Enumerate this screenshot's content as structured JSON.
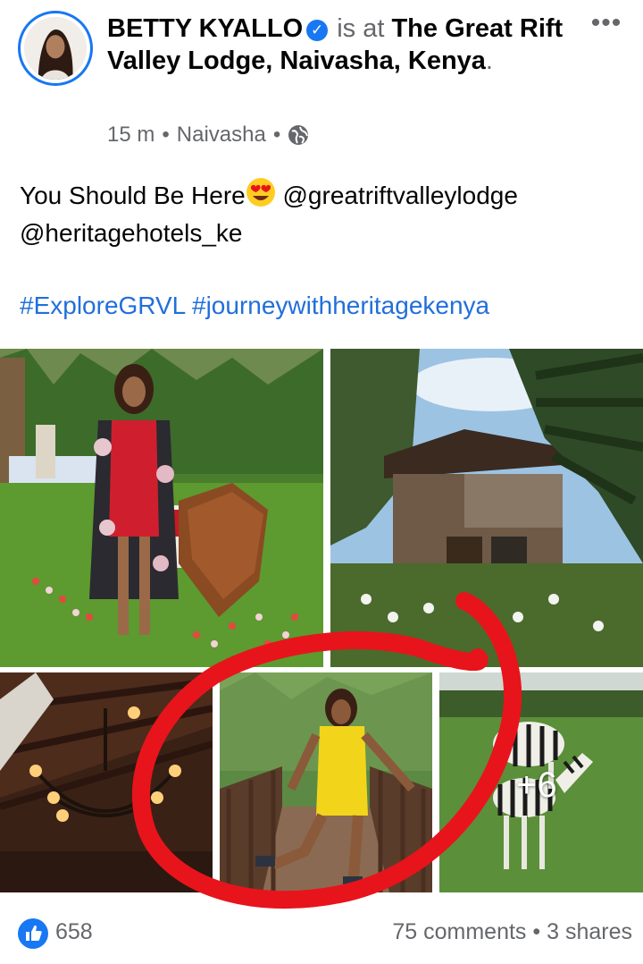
{
  "header": {
    "author": "BETTY KYALLO",
    "is_at": "is at",
    "place": "The Great Rift Valley Lodge, Naivasha, Kenya",
    "period": ".",
    "time": "15 m",
    "separator": "•",
    "location": "Naivasha",
    "separator2": "•",
    "more": "•••"
  },
  "post": {
    "text_before_emoji": "You Should Be Here",
    "text_after_emoji": " @greatriftvalleylodge @heritagehotels_ke",
    "hashtags": [
      "#ExploreGRVL",
      "#journeywithheritagekenya"
    ],
    "emoji_name": "heart-eyes-emoji"
  },
  "photos": {
    "more_count": "+6",
    "annotation_color": "#e8141b"
  },
  "footer": {
    "like_count": "658",
    "comments": "75 comments",
    "separator": "•",
    "shares": "3 shares"
  },
  "colors": {
    "accent": "#1877f2",
    "link": "#216fdb",
    "secondary_text": "#65676b"
  }
}
